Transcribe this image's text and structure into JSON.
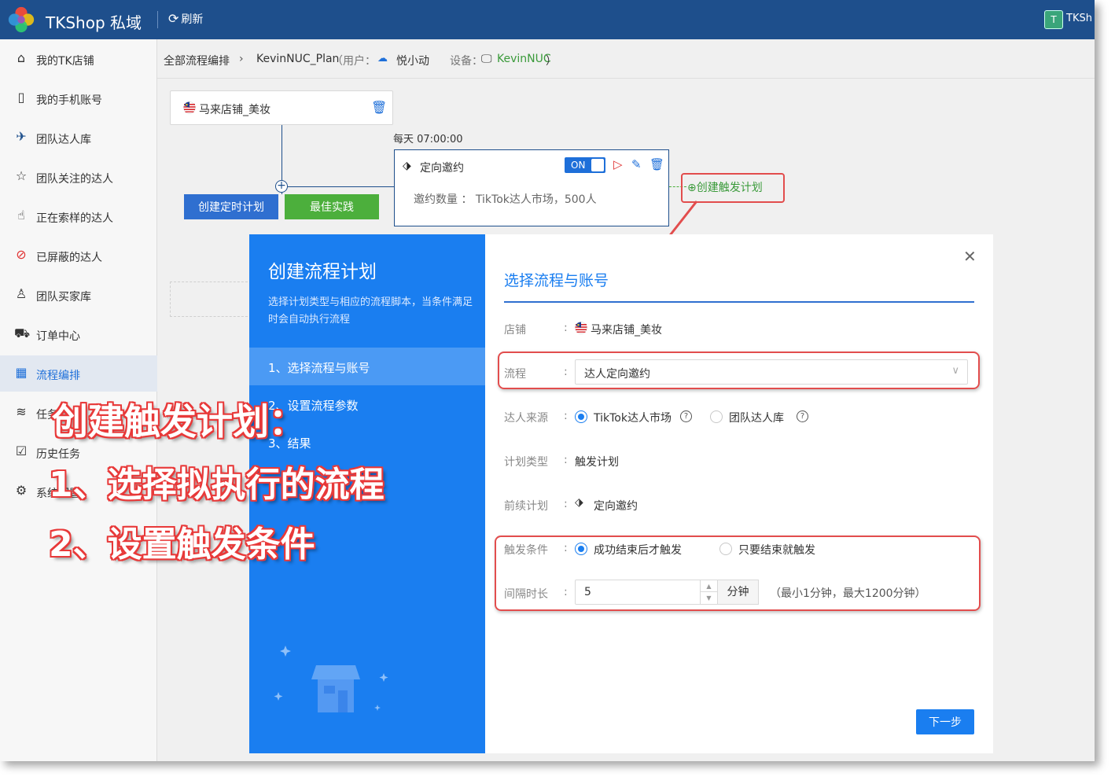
{
  "app": {
    "title": "TKShop 私域",
    "refresh_label": "刷新",
    "user_initial": "T",
    "user_name": "TKSh"
  },
  "sidebar": {
    "items": [
      {
        "label": "我的TK店铺"
      },
      {
        "label": "我的手机账号"
      },
      {
        "label": "团队达人库"
      },
      {
        "label": "团队关注的达人"
      },
      {
        "label": "正在索样的达人"
      },
      {
        "label": "已屏蔽的达人"
      },
      {
        "label": "团队买家库"
      },
      {
        "label": "订单中心"
      },
      {
        "label": "流程编排"
      },
      {
        "label": "任务"
      },
      {
        "label": "历史任务"
      },
      {
        "label": "系统配置"
      }
    ]
  },
  "breadcrumb": {
    "root": "全部流程编排",
    "plan": "KevinNUC_Plan",
    "user_prefix": "（用户：",
    "user": "悦小动",
    "device_prefix": "设备：",
    "device": "KevinNUC",
    "suffix": "）"
  },
  "canvas": {
    "shop_name": "马来店铺_美妆",
    "btn_timer": "创建定时计划",
    "btn_best": "最佳实践",
    "schedule": "每天  07:00:00",
    "plan_name": "定向邀约",
    "toggle": "ON",
    "plan_detail": "邀约数量 ：  TikTok达人市场，500人",
    "trigger_link": "创建触发计划"
  },
  "modal": {
    "title": "创建流程计划",
    "desc": "选择计划类型与相应的流程脚本，当条件满足时会自动执行流程",
    "steps": [
      {
        "label": "1、选择流程与账号"
      },
      {
        "label": "2、设置流程参数"
      },
      {
        "label": "3、结果"
      }
    ],
    "subtitle": "选择流程与账号",
    "fields": {
      "shop_label": "店铺",
      "shop_value": "马来店铺_美妆",
      "flow_label": "流程",
      "flow_value": "达人定向邀约",
      "source_label": "达人来源",
      "source_opt1": "TikTok达人市场",
      "source_opt2": "团队达人库",
      "type_label": "计划类型",
      "type_value": "触发计划",
      "prev_label": "前续计划",
      "prev_value": "定向邀约",
      "cond_label": "触发条件",
      "cond_opt1": "成功结束后才触发",
      "cond_opt2": "只要结束就触发",
      "interval_label": "间隔时长",
      "interval_value": "5",
      "interval_unit": "分钟",
      "interval_hint": "（最小1分钟，最大1200分钟）"
    },
    "next_label": "下一步"
  },
  "annotation": {
    "line1": "创建触发计划：",
    "line2": "1、选择拟执行的流程",
    "line3": "2、设置触发条件"
  },
  "colors": {
    "header": "#1e4f8c",
    "accent": "#1a7ef0",
    "highlight": "#e24d4d",
    "green": "#4caf3c"
  }
}
